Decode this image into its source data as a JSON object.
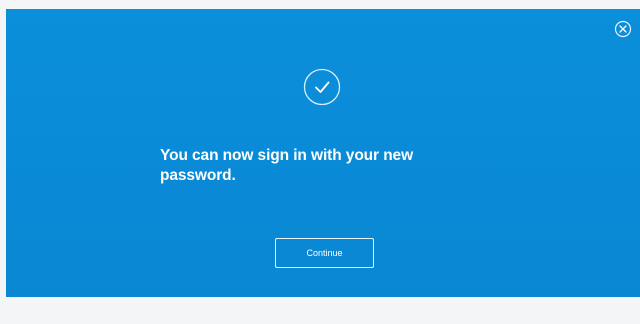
{
  "dialog": {
    "message": "You can now sign in with your new password.",
    "continue_label": "Continue",
    "close_icon": "close-circle-icon",
    "status_icon": "checkmark-circle-icon"
  },
  "colors": {
    "panel_background": "#0a8ad6",
    "text": "#ffffff",
    "page_background": "#f4f5f6"
  }
}
